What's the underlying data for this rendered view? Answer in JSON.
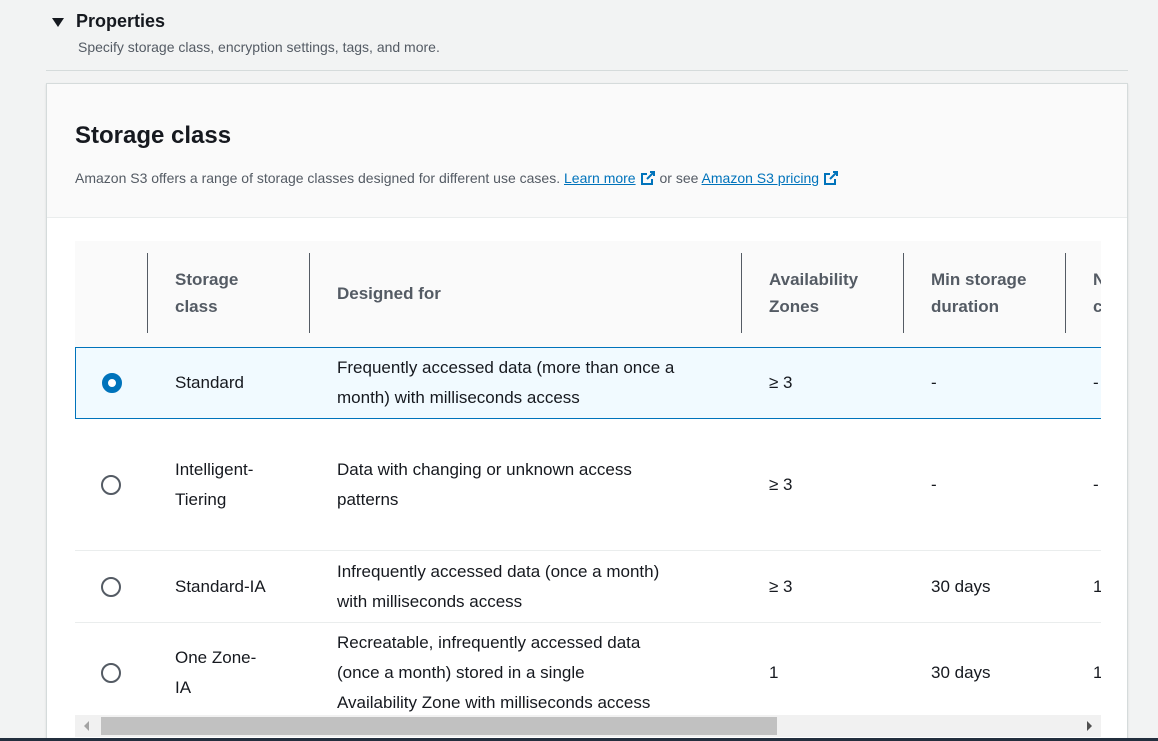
{
  "properties": {
    "title": "Properties",
    "description": "Specify storage class, encryption settings, tags, and more."
  },
  "storage_class": {
    "heading": "Storage class",
    "description": "Amazon S3 offers a range of storage classes designed for different use cases.",
    "learn_more": "Learn more",
    "or_see": "or see",
    "pricing_link": "Amazon S3 pricing",
    "columns": {
      "storage_class_l1": "Storage",
      "storage_class_l2": "class",
      "designed_for": "Designed for",
      "az_l1": "Availability",
      "az_l2": "Zones",
      "min_storage_l1": "Min storage",
      "min_storage_l2": "duration",
      "next_l1": "N",
      "next_l2": "c"
    },
    "rows": [
      {
        "selected": true,
        "name_l1": "Standard",
        "name_l2": "",
        "designed_l1": "Frequently accessed data (more than once a",
        "designed_l2": "month) with milliseconds access",
        "designed_l3": "",
        "az": "≥ 3",
        "min_duration": "-",
        "next": "-"
      },
      {
        "selected": false,
        "name_l1": "Intelligent-",
        "name_l2": "Tiering",
        "designed_l1": "Data with changing or unknown access",
        "designed_l2": "patterns",
        "designed_l3": "",
        "az": "≥ 3",
        "min_duration": "-",
        "next": "-"
      },
      {
        "selected": false,
        "name_l1": "Standard-IA",
        "name_l2": "",
        "designed_l1": "Infrequently accessed data (once a month)",
        "designed_l2": "with milliseconds access",
        "designed_l3": "",
        "az": "≥ 3",
        "min_duration": "30 days",
        "next": "1"
      },
      {
        "selected": false,
        "name_l1": "One Zone-",
        "name_l2": "IA",
        "designed_l1": "Recreatable, infrequently accessed data",
        "designed_l2": "(once a month) stored in a single",
        "designed_l3": "Availability Zone with milliseconds access",
        "az": "1",
        "min_duration": "30 days",
        "next": "1"
      }
    ]
  },
  "colors": {
    "link": "#0073bb",
    "selected_bg": "#f1faff",
    "page_bg": "#f2f3f3"
  }
}
